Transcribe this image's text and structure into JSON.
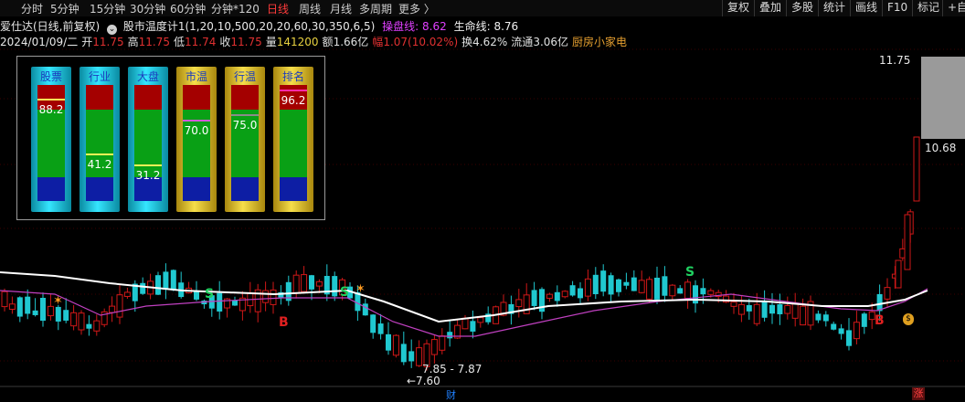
{
  "toolbar": {
    "periods": [
      "分时",
      "5分钟",
      "15分钟",
      "30分钟",
      "60分钟",
      "分钟*120",
      "日线",
      "周线",
      "月线",
      "多周期",
      "更多 〉"
    ],
    "active_period": "日线",
    "right_buttons": [
      "复权",
      "叠加",
      "多股",
      "统计",
      "画线",
      "F10",
      "标记",
      "+自"
    ]
  },
  "stock_line": {
    "name": "爱仕达(日线,前复权)",
    "indicator": "股市温度计1(1,20,10,500,20,20,60,30,350,6,5)",
    "operating_line_label": "操盘线:",
    "operating_line_value": "8.62",
    "life_line_label": "生命线:",
    "life_line_value": "8.76"
  },
  "quote_line": {
    "date": "2024/01/09/二",
    "open_label": "开",
    "open": "11.75",
    "high_label": "高",
    "high": "11.75",
    "low_label": "低",
    "low": "11.74",
    "close_label": "收",
    "close": "11.75",
    "volume_label": "量",
    "volume": "141200",
    "amount_label": "额",
    "amount": "1.66亿",
    "range_label": "幅",
    "range": "1.07(10.02%)",
    "turnover_label": "换",
    "turnover": "4.62%",
    "float_label": "流通",
    "float": "3.06亿",
    "sector": "厨房小家电"
  },
  "gauges": [
    {
      "label": "股票",
      "value": "88.2",
      "level": 88.2,
      "style": "cyan",
      "mark_color": "#f7f056"
    },
    {
      "label": "行业",
      "value": "41.2",
      "level": 41.2,
      "style": "cyan",
      "mark_color": "#f7f056"
    },
    {
      "label": "大盘",
      "value": "31.2",
      "level": 31.2,
      "style": "cyan",
      "mark_color": "#f7f056"
    },
    {
      "label": "市温",
      "value": "70.0",
      "level": 70.0,
      "style": "gold",
      "mark_color": "#d05ad8"
    },
    {
      "label": "行温",
      "value": "75.0",
      "level": 75.0,
      "style": "gold",
      "mark_color": "#8a8a8a"
    },
    {
      "label": "排名",
      "value": "96.2",
      "level": 96.2,
      "style": "gold",
      "mark_color": "#ff2aa8"
    }
  ],
  "price_labels": {
    "top": "11.75",
    "mid": "10.68",
    "low_range": "7.85 - 7.87",
    "low": "←7.60"
  },
  "markers": {
    "buy": "B",
    "sell": "S",
    "finance_tag": "财",
    "limit_up_tag": "涨",
    "money_bag": "$"
  },
  "colors": {
    "up": "#d01818",
    "down": "#20c8d0",
    "operating_line": "#ffffff",
    "life_line": "#c040c0",
    "accent_purple": "#e040ff"
  }
}
